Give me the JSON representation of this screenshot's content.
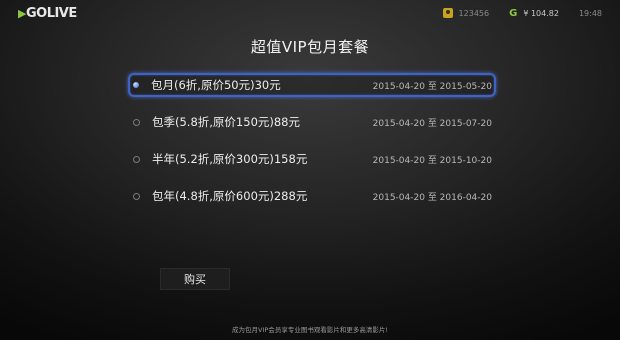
{
  "header": {
    "logo": "GOLIVE",
    "logo_mark": "▶",
    "username": "123456",
    "balance": "¥ 104.82",
    "clock": "19:48"
  },
  "page": {
    "title": "超值VIP包月套餐"
  },
  "plans": [
    {
      "label": "包月(6折,原价50元)30元",
      "dates": "2015-04-20 至 2015-05-20",
      "selected": true
    },
    {
      "label": "包季(5.8折,原价150元)88元",
      "dates": "2015-04-20 至 2015-07-20",
      "selected": false
    },
    {
      "label": "半年(5.2折,原价300元)158元",
      "dates": "2015-04-20 至 2015-10-20",
      "selected": false
    },
    {
      "label": "包年(4.8折,原价600元)288元",
      "dates": "2015-04-20 至 2016-04-20",
      "selected": false
    }
  ],
  "actions": {
    "buy_label": "购买"
  },
  "footer": {
    "note": "成为包月VIP会员享专业图书观看影片和更多高清影片!"
  },
  "colors": {
    "selection_border": "#3d63c9",
    "logo_accent": "#8ec63f",
    "user_icon": "#c9a21f"
  },
  "icons": {
    "user": "user-icon",
    "coin": "coin-icon",
    "radio_selected": "radio-selected-icon",
    "radio": "radio-icon"
  }
}
